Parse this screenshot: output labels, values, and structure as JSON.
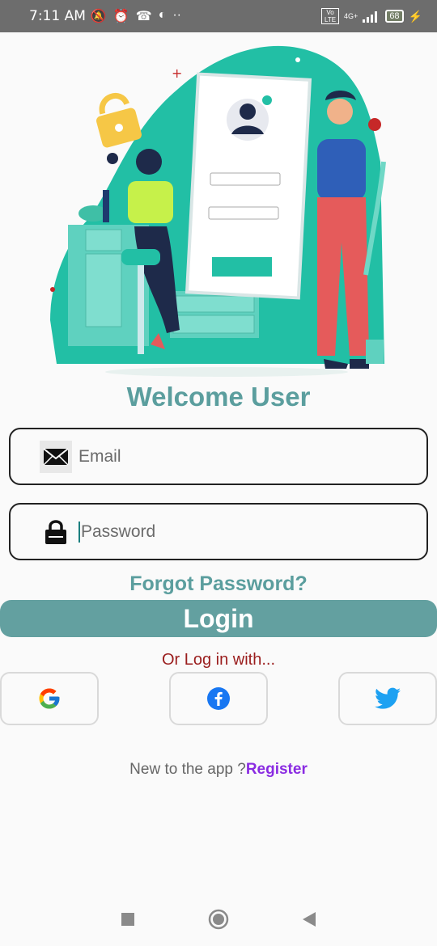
{
  "status_bar": {
    "time": "7:11 AM",
    "network": "4G+",
    "volte": "Vo LTE",
    "battery": "68"
  },
  "welcome_title": "Welcome User",
  "email_field": {
    "placeholder": "Email"
  },
  "password_field": {
    "placeholder": "Password"
  },
  "forgot_password": "Forgot Password?",
  "login_button": "Login",
  "or_login_with": "Or Log in with...",
  "social": {
    "google_icon": "google-icon",
    "facebook_icon": "facebook-icon",
    "twitter_icon": "twitter-icon"
  },
  "register": {
    "prompt": "New to the app ?",
    "link": "Register"
  },
  "colors": {
    "accent": "#5b9e9e",
    "login_bg": "#63a0a0",
    "or_text": "#9a1d1d",
    "register_link": "#8a2be2"
  }
}
